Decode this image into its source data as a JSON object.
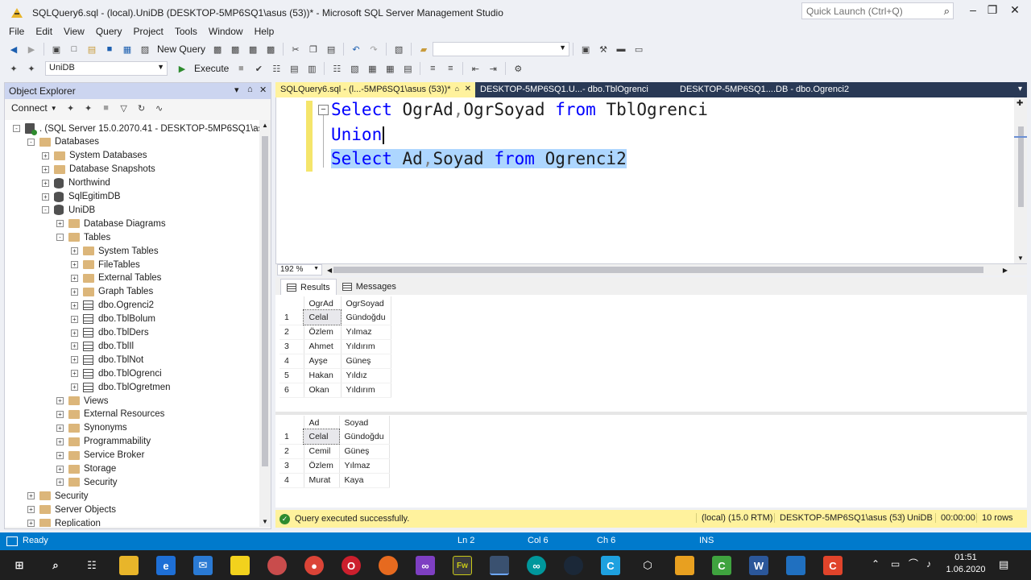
{
  "window": {
    "title": "SQLQuery6.sql - (local).UniDB (DESKTOP-5MP6SQ1\\asus (53))* - Microsoft SQL Server Management Studio",
    "quick_launch_placeholder": "Quick Launch (Ctrl+Q)"
  },
  "menu": [
    "File",
    "Edit",
    "View",
    "Query",
    "Project",
    "Tools",
    "Window",
    "Help"
  ],
  "toolbar": {
    "new_query_label": "New Query",
    "database": "UniDB",
    "execute_label": "Execute"
  },
  "object_explorer": {
    "title": "Object Explorer",
    "connect_label": "Connect",
    "nodes": [
      {
        "label": ". (SQL Server 15.0.2070.41 - DESKTOP-5MP6SQ1\\asus)",
        "depth": 0,
        "icon": "server",
        "expander": "-"
      },
      {
        "label": "Databases",
        "depth": 1,
        "icon": "folder",
        "expander": "-"
      },
      {
        "label": "System Databases",
        "depth": 2,
        "icon": "folder",
        "expander": "+"
      },
      {
        "label": "Database Snapshots",
        "depth": 2,
        "icon": "folder",
        "expander": "+"
      },
      {
        "label": "Northwind",
        "depth": 2,
        "icon": "database",
        "expander": "+"
      },
      {
        "label": "SqlEgitimDB",
        "depth": 2,
        "icon": "database",
        "expander": "+"
      },
      {
        "label": "UniDB",
        "depth": 2,
        "icon": "database",
        "expander": "-"
      },
      {
        "label": "Database Diagrams",
        "depth": 3,
        "icon": "folder",
        "expander": "+"
      },
      {
        "label": "Tables",
        "depth": 3,
        "icon": "folder",
        "expander": "-"
      },
      {
        "label": "System Tables",
        "depth": 4,
        "icon": "folder",
        "expander": "+"
      },
      {
        "label": "FileTables",
        "depth": 4,
        "icon": "folder",
        "expander": "+"
      },
      {
        "label": "External Tables",
        "depth": 4,
        "icon": "folder",
        "expander": "+"
      },
      {
        "label": "Graph Tables",
        "depth": 4,
        "icon": "folder",
        "expander": "+"
      },
      {
        "label": "dbo.Ogrenci2",
        "depth": 4,
        "icon": "table",
        "expander": "+"
      },
      {
        "label": "dbo.TblBolum",
        "depth": 4,
        "icon": "table",
        "expander": "+"
      },
      {
        "label": "dbo.TblDers",
        "depth": 4,
        "icon": "table",
        "expander": "+"
      },
      {
        "label": "dbo.TblIl",
        "depth": 4,
        "icon": "table",
        "expander": "+"
      },
      {
        "label": "dbo.TblNot",
        "depth": 4,
        "icon": "table",
        "expander": "+"
      },
      {
        "label": "dbo.TblOgrenci",
        "depth": 4,
        "icon": "table",
        "expander": "+"
      },
      {
        "label": "dbo.TblOgretmen",
        "depth": 4,
        "icon": "table",
        "expander": "+"
      },
      {
        "label": "Views",
        "depth": 3,
        "icon": "folder",
        "expander": "+"
      },
      {
        "label": "External Resources",
        "depth": 3,
        "icon": "folder",
        "expander": "+"
      },
      {
        "label": "Synonyms",
        "depth": 3,
        "icon": "folder",
        "expander": "+"
      },
      {
        "label": "Programmability",
        "depth": 3,
        "icon": "folder",
        "expander": "+"
      },
      {
        "label": "Service Broker",
        "depth": 3,
        "icon": "folder",
        "expander": "+"
      },
      {
        "label": "Storage",
        "depth": 3,
        "icon": "folder",
        "expander": "+"
      },
      {
        "label": "Security",
        "depth": 3,
        "icon": "folder",
        "expander": "+"
      },
      {
        "label": "Security",
        "depth": 1,
        "icon": "folder",
        "expander": "+"
      },
      {
        "label": "Server Objects",
        "depth": 1,
        "icon": "folder",
        "expander": "+"
      },
      {
        "label": "Replication",
        "depth": 1,
        "icon": "folder",
        "expander": "+"
      }
    ]
  },
  "tabs": [
    {
      "label": "SQLQuery6.sql - (l...-5MP6SQ1\\asus (53))*",
      "active": true
    },
    {
      "label": "DESKTOP-5MP6SQ1.U...- dbo.TblOgrenci",
      "active": false
    },
    {
      "label": "DESKTOP-5MP6SQ1....DB - dbo.Ogrenci2",
      "active": false
    }
  ],
  "editor": {
    "line1": {
      "kw1": "Select",
      "cols": "OgrAd",
      "comma": ",",
      "cols2": "OgrSoyad",
      "kw2": "from",
      "table": "TblOgrenci"
    },
    "line2": {
      "kw": "Union"
    },
    "line3": {
      "kw1": "Select",
      "cols": "Ad",
      "comma": ",",
      "cols2": "Soyad",
      "kw2": "from",
      "table": "Ogrenci2"
    },
    "zoom": "192 %"
  },
  "results": {
    "tab_results": "Results",
    "tab_messages": "Messages",
    "grid1": {
      "columns": [
        "OgrAd",
        "OgrSoyad"
      ],
      "rows": [
        [
          "1",
          "Celal",
          "Gündoğdu"
        ],
        [
          "2",
          "Özlem",
          "Yılmaz"
        ],
        [
          "3",
          "Ahmet",
          "Yıldırım"
        ],
        [
          "4",
          "Ayşe",
          "Güneş"
        ],
        [
          "5",
          "Hakan",
          "Yıldız"
        ],
        [
          "6",
          "Okan",
          "Yıldırım"
        ]
      ]
    },
    "grid2": {
      "columns": [
        "Ad",
        "Soyad"
      ],
      "rows": [
        [
          "1",
          "Celal",
          "Gündoğdu"
        ],
        [
          "2",
          "Cemil",
          "Güneş"
        ],
        [
          "3",
          "Özlem",
          "Yılmaz"
        ],
        [
          "4",
          "Murat",
          "Kaya"
        ]
      ]
    }
  },
  "query_status": {
    "message": "Query executed successfully.",
    "server": "(local) (15.0 RTM)",
    "user": "DESKTOP-5MP6SQ1\\asus (53)",
    "database": "UniDB",
    "elapsed": "00:00:00",
    "rows": "10 rows"
  },
  "statusbar": {
    "ready": "Ready",
    "ln": "Ln 2",
    "col": "Col 6",
    "ch": "Ch 6",
    "mode": "INS"
  },
  "clock": {
    "time": "01:51",
    "date": "1.06.2020"
  },
  "colors": {
    "accent": "#007acc",
    "active_tab": "#fff29d",
    "tab_strip": "#293955",
    "keyword": "#0000ff",
    "selection": "#add6ff"
  }
}
